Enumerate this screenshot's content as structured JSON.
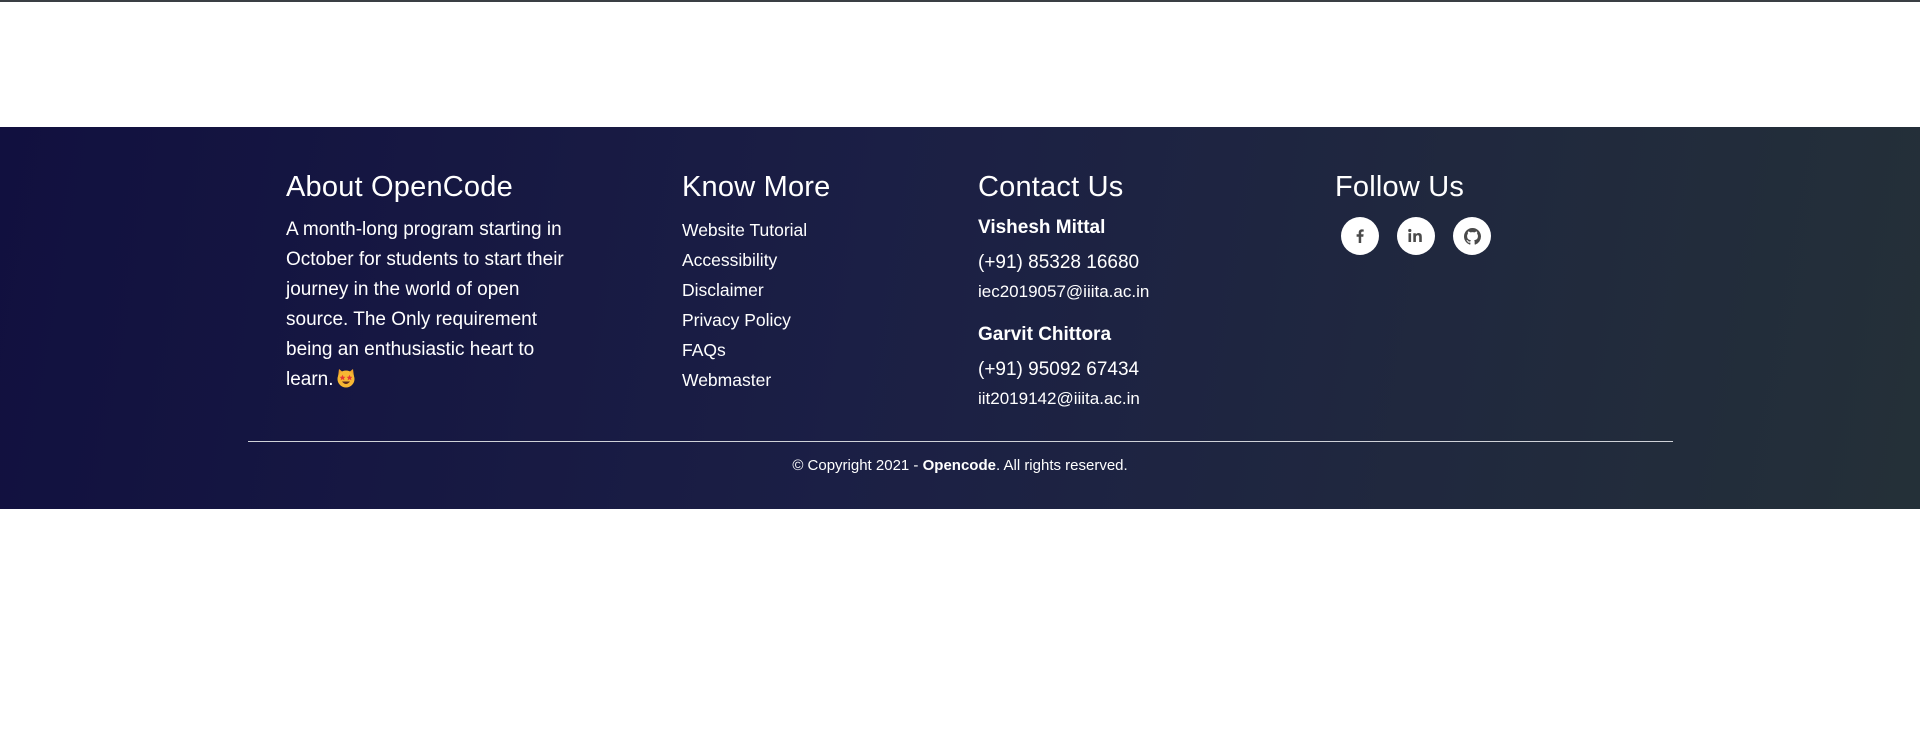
{
  "about": {
    "title": "About OpenCode",
    "text": "A month-long program starting in October for students to start their journey in the world of open source. The Only requirement being an enthusiastic heart to learn.",
    "emoji_icon": "star-struck-cat-emoji"
  },
  "know_more": {
    "title": "Know More",
    "links": [
      {
        "label": "Website Tutorial"
      },
      {
        "label": "Accessibility"
      },
      {
        "label": "Disclaimer"
      },
      {
        "label": "Privacy Policy"
      },
      {
        "label": "FAQs"
      },
      {
        "label": "Webmaster"
      }
    ]
  },
  "contact": {
    "title": "Contact Us",
    "people": [
      {
        "name": "Vishesh Mittal",
        "phone": "(+91) 85328 16680",
        "email": "iec2019057@iiita.ac.in"
      },
      {
        "name": "Garvit Chittora",
        "phone": "(+91) 95092 67434",
        "email": "iit2019142@iiita.ac.in"
      }
    ]
  },
  "follow": {
    "title": "Follow Us",
    "icons": [
      "facebook-icon",
      "linkedin-icon",
      "github-icon"
    ]
  },
  "copyright": {
    "prefix": "© Copyright 2021 - ",
    "brand": "Opencode",
    "suffix": ". All rights reserved."
  },
  "colors": {
    "gradient_start": "#11103f",
    "gradient_end": "#243038",
    "text": "#ffffff",
    "icon": "#4a4a4a"
  }
}
